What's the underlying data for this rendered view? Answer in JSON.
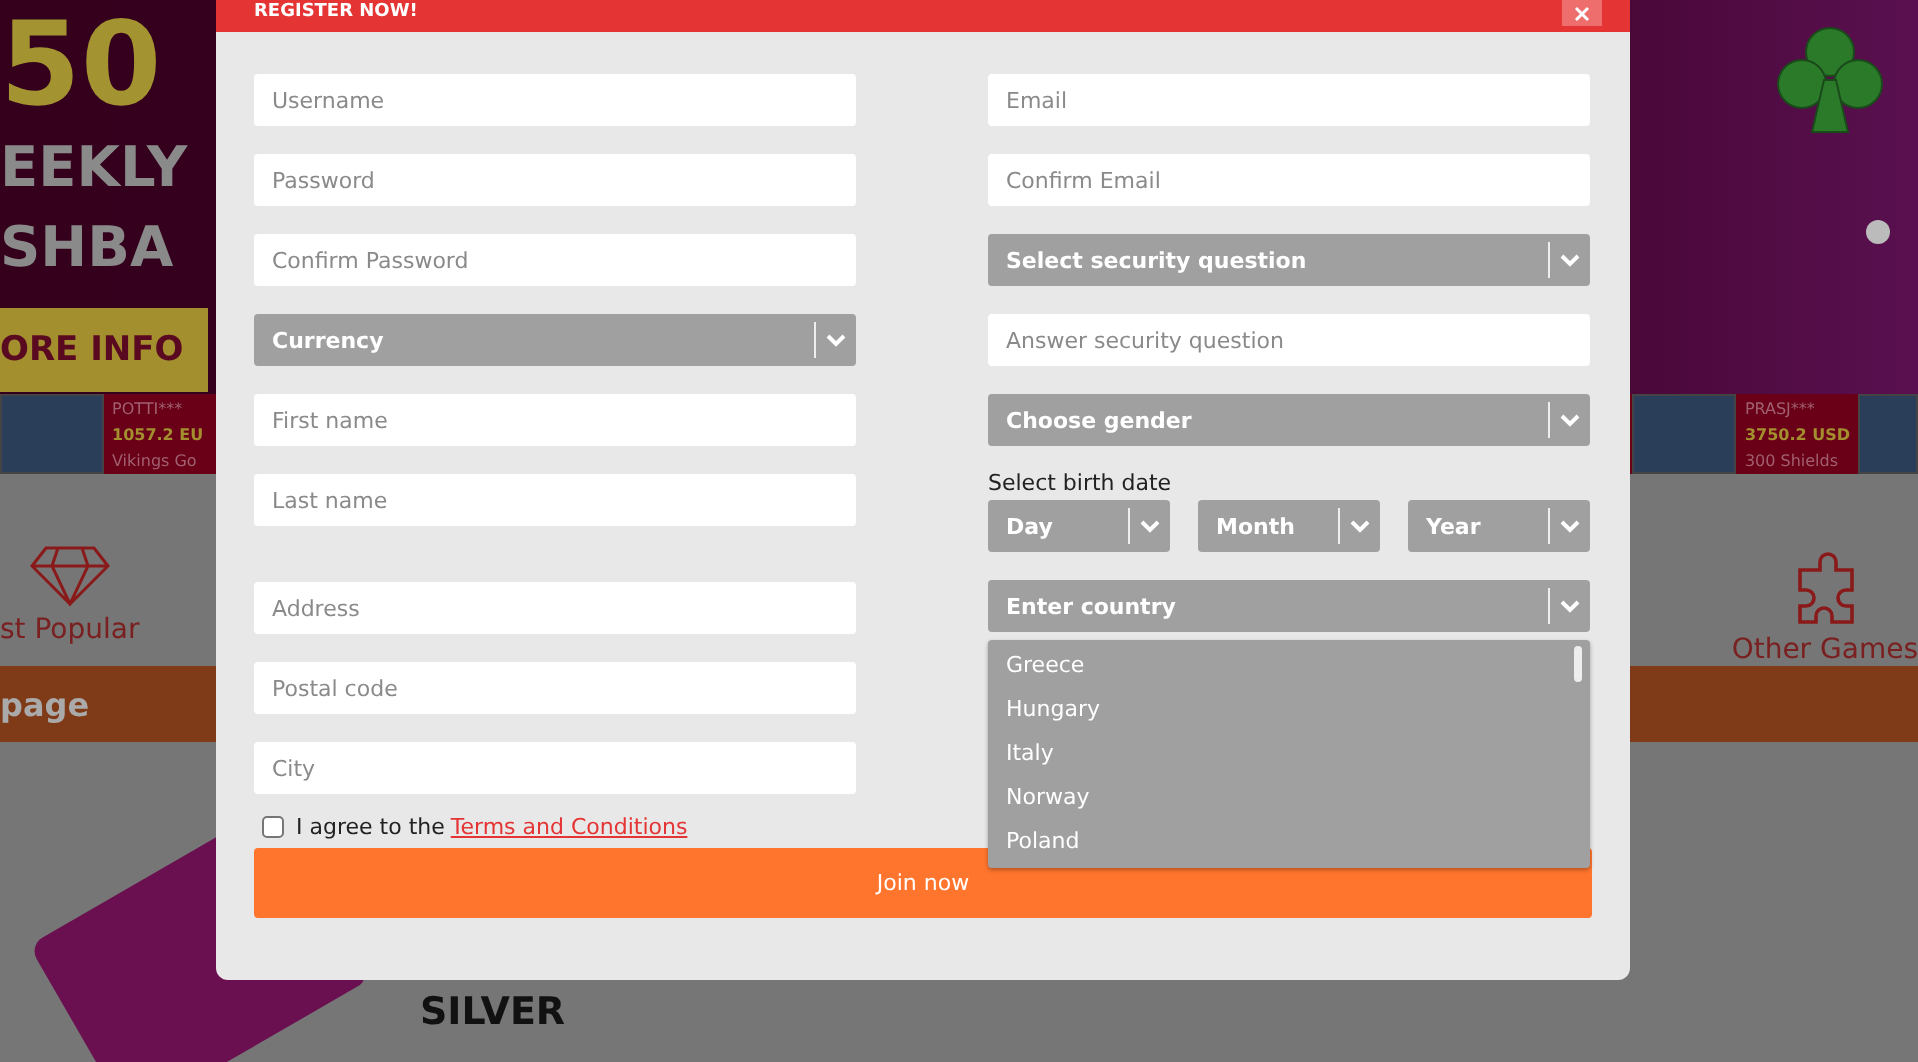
{
  "hero": {
    "amount": "50",
    "lines": [
      "EEKLY",
      "SHBA"
    ],
    "button": "ORE INFO"
  },
  "winners": [
    {
      "name": "POTTI***",
      "amount": "1057.2 EU",
      "game": "Vikings Go"
    },
    {
      "name": "PRASJ***",
      "amount": "3750.2 USD",
      "game": "300 Shields"
    }
  ],
  "categories": [
    {
      "label": "st Popular",
      "kind": "diamond"
    },
    {
      "label": "Other Games",
      "kind": "puzzle"
    }
  ],
  "nav_bar": {
    "label": "page"
  },
  "section": {
    "title": "SILVER"
  },
  "dialog": {
    "title": "REGISTER NOW!",
    "left_fields": [
      {
        "kind": "input",
        "placeholder": "Username"
      },
      {
        "kind": "input",
        "placeholder": "Password"
      },
      {
        "kind": "input",
        "placeholder": "Confirm Password"
      },
      {
        "kind": "select",
        "label": "Currency"
      },
      {
        "kind": "input",
        "placeholder": "First name"
      },
      {
        "kind": "input",
        "placeholder": "Last name"
      },
      {
        "kind": "gap"
      },
      {
        "kind": "input",
        "placeholder": "Address"
      },
      {
        "kind": "input",
        "placeholder": "Postal code"
      },
      {
        "kind": "input",
        "placeholder": "City"
      }
    ],
    "right_fields": [
      {
        "kind": "input",
        "placeholder": "Email"
      },
      {
        "kind": "input",
        "placeholder": "Confirm Email"
      },
      {
        "kind": "select",
        "label": "Select security question"
      },
      {
        "kind": "input",
        "placeholder": "Answer security question"
      },
      {
        "kind": "select",
        "label": "Choose gender"
      }
    ],
    "birth_date": {
      "label": "Select birth date",
      "selects": [
        "Day",
        "Month",
        "Year"
      ]
    },
    "country": {
      "label": "Enter country",
      "expanded": true,
      "options": [
        "Greece",
        "Hungary",
        "Italy",
        "Norway",
        "Poland"
      ]
    },
    "agree": {
      "checked": false,
      "text": "I agree to the",
      "link": "Terms and Conditions"
    },
    "submit": "Join now"
  }
}
